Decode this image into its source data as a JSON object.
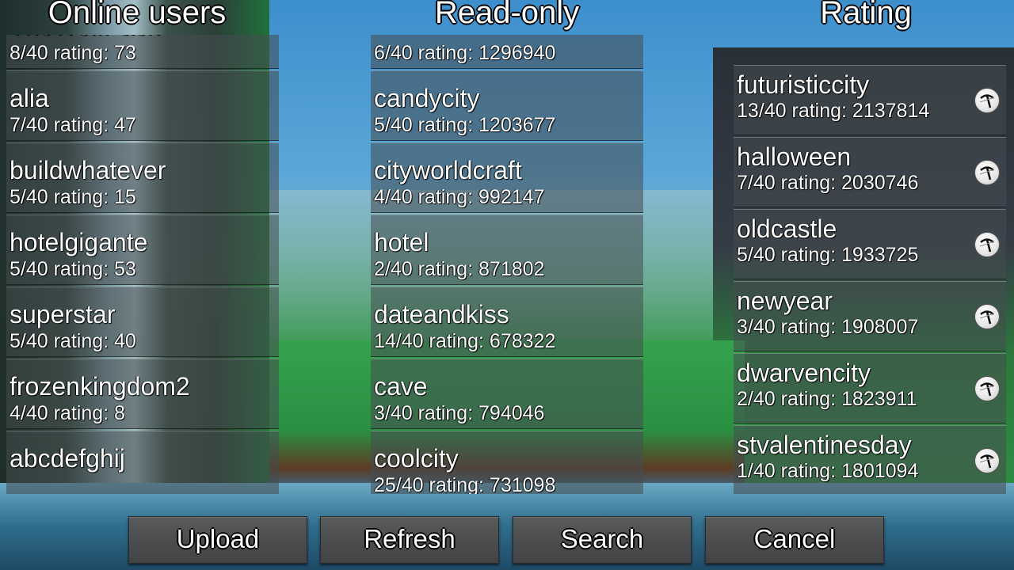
{
  "columns": {
    "online_users": {
      "title": "Online users",
      "items": [
        {
          "name": "TheWolfPack",
          "info": "8/40 rating: 73"
        },
        {
          "name": "alia",
          "info": "7/40 rating: 47"
        },
        {
          "name": "buildwhatever",
          "info": "5/40 rating: 15"
        },
        {
          "name": "hotelgigante",
          "info": "5/40 rating: 53"
        },
        {
          "name": "superstar",
          "info": "5/40 rating: 40"
        },
        {
          "name": "frozenkingdom2",
          "info": "4/40 rating: 8"
        },
        {
          "name": "abcdefghij",
          "info": ""
        }
      ]
    },
    "read_only": {
      "title": "Read-only",
      "items": [
        {
          "name": "",
          "info": "6/40 rating: 1296940"
        },
        {
          "name": "candycity",
          "info": "5/40 rating: 1203677"
        },
        {
          "name": "cityworldcraft",
          "info": "4/40 rating: 992147"
        },
        {
          "name": "hotel",
          "info": "2/40 rating: 871802"
        },
        {
          "name": "dateandkiss",
          "info": "14/40 rating: 678322"
        },
        {
          "name": "cave",
          "info": "3/40 rating: 794046"
        },
        {
          "name": "coolcity",
          "info": "25/40 rating: 731098"
        }
      ]
    },
    "rating": {
      "title": "Rating",
      "items": [
        {
          "name": "futuristiccity",
          "info": "13/40 rating: 2137814",
          "icon": "pickaxe-icon"
        },
        {
          "name": "halloween",
          "info": "7/40 rating: 2030746",
          "icon": "pickaxe-icon"
        },
        {
          "name": "oldcastle",
          "info": "5/40 rating: 1933725",
          "icon": "pickaxe-icon"
        },
        {
          "name": "newyear",
          "info": "3/40 rating: 1908007",
          "icon": "pickaxe-icon"
        },
        {
          "name": "dwarvencity",
          "info": "2/40 rating: 1823911",
          "icon": "pickaxe-icon"
        },
        {
          "name": "stvalentinesday",
          "info": "1/40 rating: 1801094",
          "icon": "pickaxe-icon"
        }
      ]
    }
  },
  "buttons": {
    "upload": "Upload",
    "refresh": "Refresh",
    "search": "Search",
    "cancel": "Cancel"
  }
}
